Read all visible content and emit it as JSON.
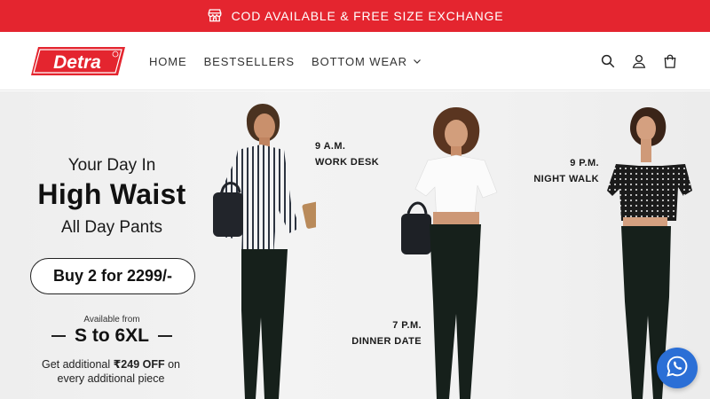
{
  "announcement": {
    "text": "COD AVAILABLE & FREE SIZE EXCHANGE",
    "icon": "store-icon"
  },
  "header": {
    "logo_text": "Detra",
    "nav": [
      {
        "label": "HOME"
      },
      {
        "label": "BESTSELLERS"
      },
      {
        "label": "BOTTOM WEAR",
        "has_dropdown": true
      }
    ],
    "icons": [
      "search-icon",
      "account-icon",
      "cart-icon"
    ]
  },
  "hero": {
    "line1": "Your Day In",
    "line2": "High Waist",
    "line3": "All Day Pants",
    "offer_button": "Buy 2 for 2299/-",
    "available_label": "Available from",
    "size_range": "S to 6XL",
    "extra_offer_prefix": "Get additional ",
    "extra_offer_amount": "₹249 OFF",
    "extra_offer_suffix": " on every additional piece",
    "models": [
      {
        "time": "9 A.M.",
        "caption": "WORK DESK"
      },
      {
        "time": "7 P.M.",
        "caption": "DINNER DATE"
      },
      {
        "time": "9 P.M.",
        "caption": "NIGHT WALK"
      }
    ]
  },
  "colors": {
    "announcement_bg": "#e4252f",
    "logo_red": "#e4252f",
    "pants": "#16201b",
    "whatsapp_bg": "#2b6fd6"
  }
}
